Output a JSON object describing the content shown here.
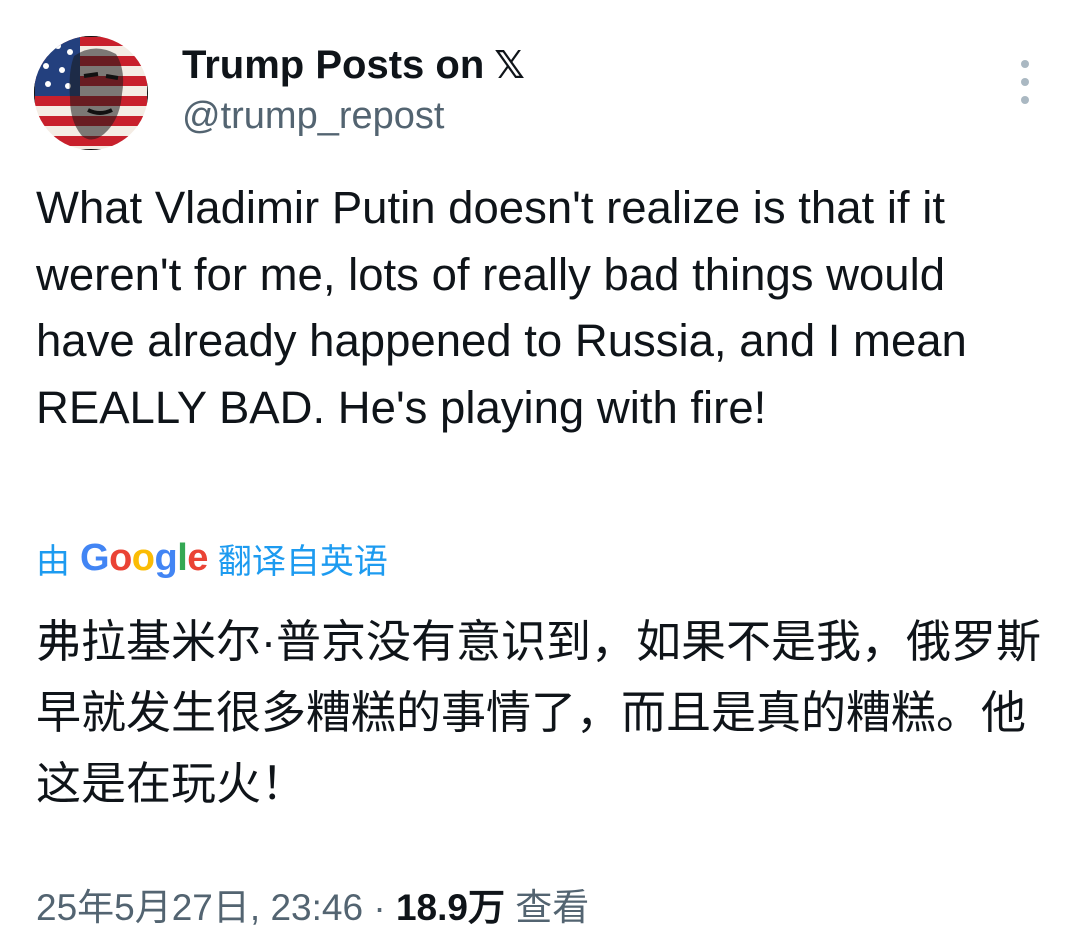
{
  "author": {
    "display_name": "Trump Posts on",
    "x_logo": "𝕏",
    "handle": "@trump_repost",
    "avatar_icon": "flag-face-avatar"
  },
  "tweet": {
    "text": "What Vladimir Putin doesn't realize is that if it weren't for me, lots of really bad things would have already happened to Russia, and I mean REALLY BAD. He's playing with fire!"
  },
  "translation": {
    "by_label": "由",
    "google": [
      "G",
      "o",
      "o",
      "g",
      "l",
      "e"
    ],
    "suffix_label": "翻译自英语",
    "text": "弗拉基米尔·普京没有意识到，如果不是我，俄罗斯早就发生很多糟糕的事情了，而且是真的糟糕。他这是在玩火！",
    "link_color": "#1d9bf0"
  },
  "meta": {
    "timestamp": "25年5月27日, 23:46",
    "separator": "·",
    "views_count": "18.9万",
    "views_label": "查看"
  },
  "more_icon": "more-vertical-icon"
}
